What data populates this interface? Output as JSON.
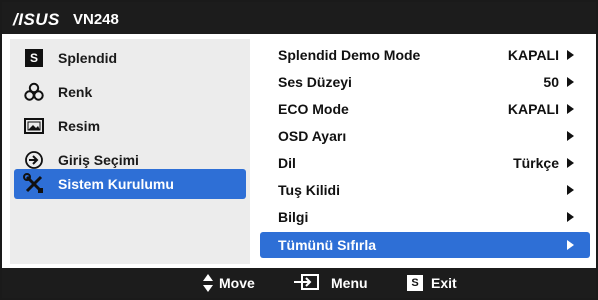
{
  "title_bar": {
    "brand": "/ISUS",
    "model": "VN248"
  },
  "left_menu": {
    "items": [
      {
        "label": "Splendid",
        "icon": "splendid-s-icon"
      },
      {
        "label": "Renk",
        "icon": "color-rings-icon"
      },
      {
        "label": "Resim",
        "icon": "picture-icon"
      },
      {
        "label": "Giriş Seçimi",
        "icon": "input-arrow-icon"
      },
      {
        "label": "Sistem Kurulumu",
        "icon": "wrench-screwdriver-icon",
        "selected": true
      }
    ]
  },
  "right_menu": {
    "items": [
      {
        "label": "Splendid Demo Mode",
        "value": "KAPALI"
      },
      {
        "label": "Ses Düzeyi",
        "value": "50"
      },
      {
        "label": "ECO Mode",
        "value": "KAPALI"
      },
      {
        "label": "OSD Ayarı",
        "value": ""
      },
      {
        "label": "Dil",
        "value": "Türkçe"
      },
      {
        "label": "Tuş Kilidi",
        "value": ""
      },
      {
        "label": "Bilgi",
        "value": ""
      },
      {
        "label": "Tümünü Sıfırla",
        "value": "",
        "selected": true
      }
    ]
  },
  "footer": {
    "move_label": "Move",
    "menu_label": "Menu",
    "exit_label": "Exit",
    "exit_icon_letter": "S"
  },
  "colors": {
    "highlight": "#2e6fd6",
    "bar": "#1c1c1c",
    "panel": "#ececec"
  }
}
